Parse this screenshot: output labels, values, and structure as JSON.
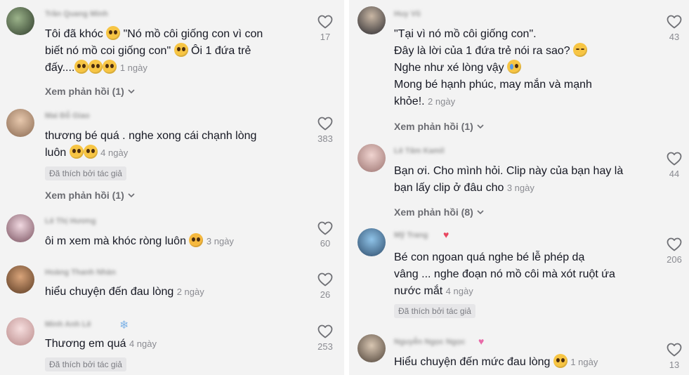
{
  "left": {
    "comments": [
      {
        "username": "Trần Quang Minh",
        "text": "Tôi đã khóc",
        "text2": "\"Nó mồ côi giống con vì con",
        "line2": "biết nó mồ coi giống con\"",
        "line2b": "Ôi 1 đứa trẻ",
        "line3": "đấy....",
        "time": "1 ngày",
        "likes": "17",
        "view_replies": "Xem phản hồi (1)"
      },
      {
        "username": "Mai Đỗ Giao",
        "line1": "thương bé quá . nghe xong cái chạnh lòng",
        "line2": "luôn",
        "time": "4 ngày",
        "liked_badge": "Đã thích bởi tác giả",
        "likes": "383",
        "view_replies": "Xem phản hồi (1)"
      },
      {
        "username": "Lê Thị Hương",
        "line1": "ôi m xem mà khóc ròng luôn",
        "time": "3 ngày",
        "likes": "60"
      },
      {
        "username": "Hoàng Thanh Nhàn",
        "line1": "hiểu chuyện đến đau lòng",
        "time": "2 ngày",
        "likes": "26"
      },
      {
        "username": "Minh Anh Lê",
        "line1": "Thương em quá",
        "time": "4 ngày",
        "liked_badge": "Đã thích bởi tác giả",
        "likes": "253"
      }
    ]
  },
  "right": {
    "comments": [
      {
        "username": "Huy Vũ",
        "line1": "\"Tại vì nó mồ côi giống con\".",
        "line2": "Đây là lời của 1 đứa trẻ nói ra sao?",
        "line3": "Nghe như xé lòng vậy",
        "line4": "Mong bé hạnh phúc, may mắn và mạnh",
        "line5": "khỏe!.",
        "time": "2 ngày",
        "likes": "43",
        "view_replies": "Xem phản hồi (1)"
      },
      {
        "username": "Lê Tâm Kamil",
        "line1": "Bạn ơi. Cho mình hỏi. Clip này của bạn hay là",
        "line2": "bạn lấy clip ở đâu cho",
        "time": "3 ngày",
        "likes": "44",
        "view_replies": "Xem phản hồi (8)"
      },
      {
        "username": "Mỹ Trang",
        "line1": "Bé con ngoan quá nghe bé lễ phép dạ",
        "line2": "vâng ... nghe đoạn nó mồ côi mà xót ruột ứa",
        "line3": "nước mắt",
        "time": "4 ngày",
        "liked_badge": "Đã thích bởi tác giả",
        "likes": "206"
      },
      {
        "username": "Nguyễn Ngọc Ngọc",
        "line1": "Hiểu chuyện đến mức đau lòng",
        "time": "1 ngày",
        "likes": "13"
      }
    ]
  },
  "icons": {
    "like": "heart-outline-icon",
    "chevron": "chevron-down-icon"
  },
  "colors": {
    "background": "#f3f3f3",
    "text": "#161823",
    "meta": "#8a8b91"
  }
}
